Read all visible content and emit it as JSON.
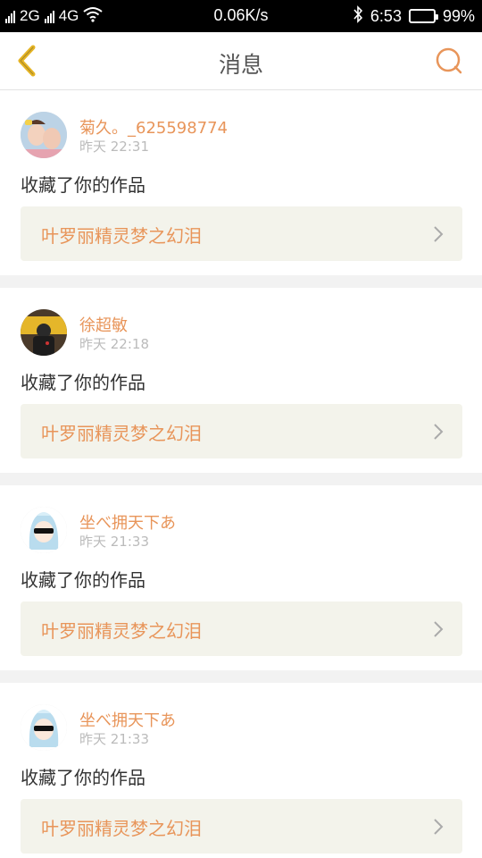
{
  "status_bar": {
    "network_2g": "2G",
    "network_4g": "4G",
    "speed": "0.06K/s",
    "time": "6:53",
    "battery": "99%",
    "battery_level": 0.99
  },
  "header": {
    "title": "消息"
  },
  "messages": [
    {
      "username": "菊久。_625598774",
      "time": "昨天 22:31",
      "action": "收藏了你的作品",
      "work_title": "叶罗丽精灵梦之幻泪"
    },
    {
      "username": "徐超敏",
      "time": "昨天 22:18",
      "action": "收藏了你的作品",
      "work_title": "叶罗丽精灵梦之幻泪"
    },
    {
      "username": "坐べ拥天下あ",
      "time": "昨天 21:33",
      "action": "收藏了你的作品",
      "work_title": "叶罗丽精灵梦之幻泪"
    },
    {
      "username": "坐べ拥天下あ",
      "time": "昨天 21:33",
      "action": "收藏了你的作品",
      "work_title": "叶罗丽精灵梦之幻泪"
    }
  ],
  "colors": {
    "accent": "#e8955a",
    "back_arrow": "#e5b424",
    "card_link_bg": "#f3f3eb"
  }
}
